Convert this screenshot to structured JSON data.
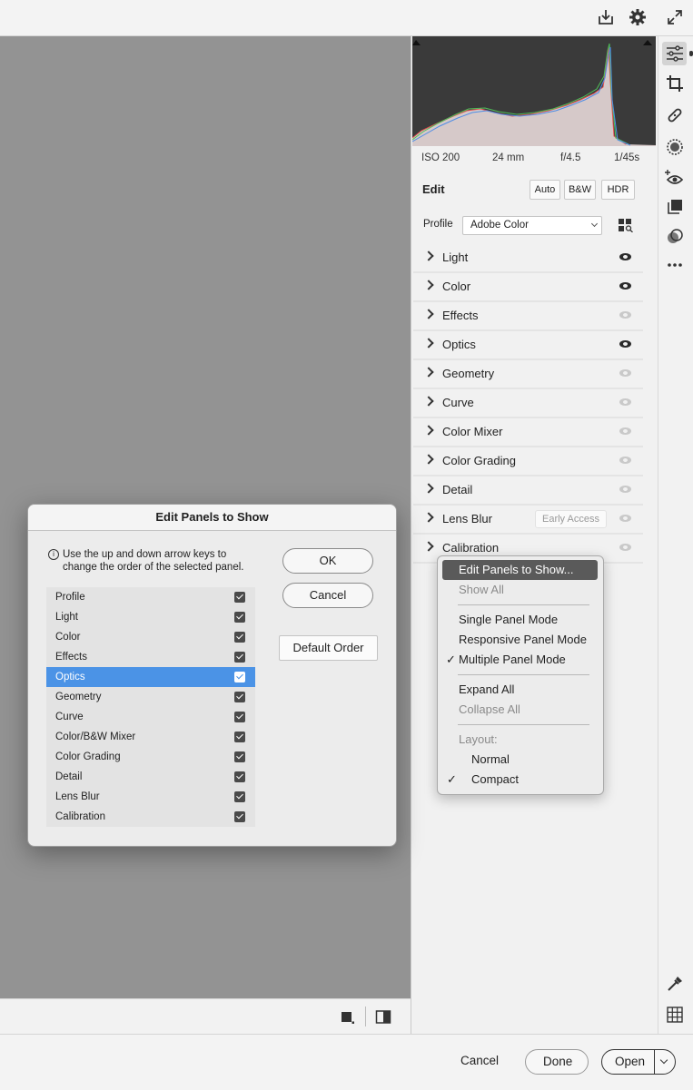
{
  "camera_info": {
    "iso": "ISO 200",
    "focal_length": "24 mm",
    "aperture": "f/4.5",
    "shutter": "1/45s"
  },
  "edit": {
    "title": "Edit",
    "auto_label": "Auto",
    "bw_label": "B&W",
    "hdr_label": "HDR"
  },
  "profile": {
    "label": "Profile",
    "value": "Adobe Color"
  },
  "panels": [
    {
      "label": "Light",
      "visible": true
    },
    {
      "label": "Color",
      "visible": true
    },
    {
      "label": "Effects",
      "visible": false
    },
    {
      "label": "Optics",
      "visible": true
    },
    {
      "label": "Geometry",
      "visible": false
    },
    {
      "label": "Curve",
      "visible": false
    },
    {
      "label": "Color Mixer",
      "visible": false
    },
    {
      "label": "Color Grading",
      "visible": false
    },
    {
      "label": "Detail",
      "visible": false
    },
    {
      "label": "Lens Blur",
      "visible": false,
      "badge": "Early Access"
    },
    {
      "label": "Calibration",
      "visible": false
    }
  ],
  "context_menu": {
    "items": [
      {
        "label": "Edit Panels to Show...",
        "state": "highlighted"
      },
      {
        "label": "Show All",
        "state": "disabled"
      },
      {
        "label": "Single Panel Mode",
        "state": "normal"
      },
      {
        "label": "Responsive Panel Mode",
        "state": "normal"
      },
      {
        "label": "Multiple Panel Mode",
        "state": "checked"
      },
      {
        "label": "Expand All",
        "state": "normal"
      },
      {
        "label": "Collapse All",
        "state": "disabled"
      },
      {
        "label": "Layout:",
        "state": "disabled"
      },
      {
        "label": "Normal",
        "state": "normal"
      },
      {
        "label": "Compact",
        "state": "checked"
      }
    ],
    "check_glyph": "✓"
  },
  "dialog": {
    "title": "Edit Panels to Show",
    "info_text": "Use the up and down arrow keys to change the order of the selected panel.",
    "ok_label": "OK",
    "cancel_label": "Cancel",
    "default_order_label": "Default Order",
    "selected_item": "Optics",
    "items": [
      {
        "label": "Profile",
        "checked": true
      },
      {
        "label": "Light",
        "checked": true
      },
      {
        "label": "Color",
        "checked": true
      },
      {
        "label": "Effects",
        "checked": true
      },
      {
        "label": "Optics",
        "checked": true
      },
      {
        "label": "Geometry",
        "checked": true
      },
      {
        "label": "Curve",
        "checked": true
      },
      {
        "label": "Color/B&W Mixer",
        "checked": true
      },
      {
        "label": "Color Grading",
        "checked": true
      },
      {
        "label": "Detail",
        "checked": true
      },
      {
        "label": "Lens Blur",
        "checked": true
      },
      {
        "label": "Calibration",
        "checked": true
      }
    ]
  },
  "bottom_bar": {
    "cancel_label": "Cancel",
    "done_label": "Done",
    "open_label": "Open"
  },
  "colors": {
    "canvas_gray": "#939393",
    "selection_blue": "#4b93e6",
    "menu_highlight": "#5a5a5a"
  },
  "icons": {
    "top": [
      "save-icon",
      "gear-icon",
      "expand-icon"
    ],
    "toolbar": [
      "sliders-icon",
      "crop-icon",
      "healing-icon",
      "masking-icon",
      "red-eye-icon",
      "presets-icon",
      "snapshots-icon",
      "more-icon",
      "eyedropper-icon",
      "grid-icon"
    ]
  }
}
